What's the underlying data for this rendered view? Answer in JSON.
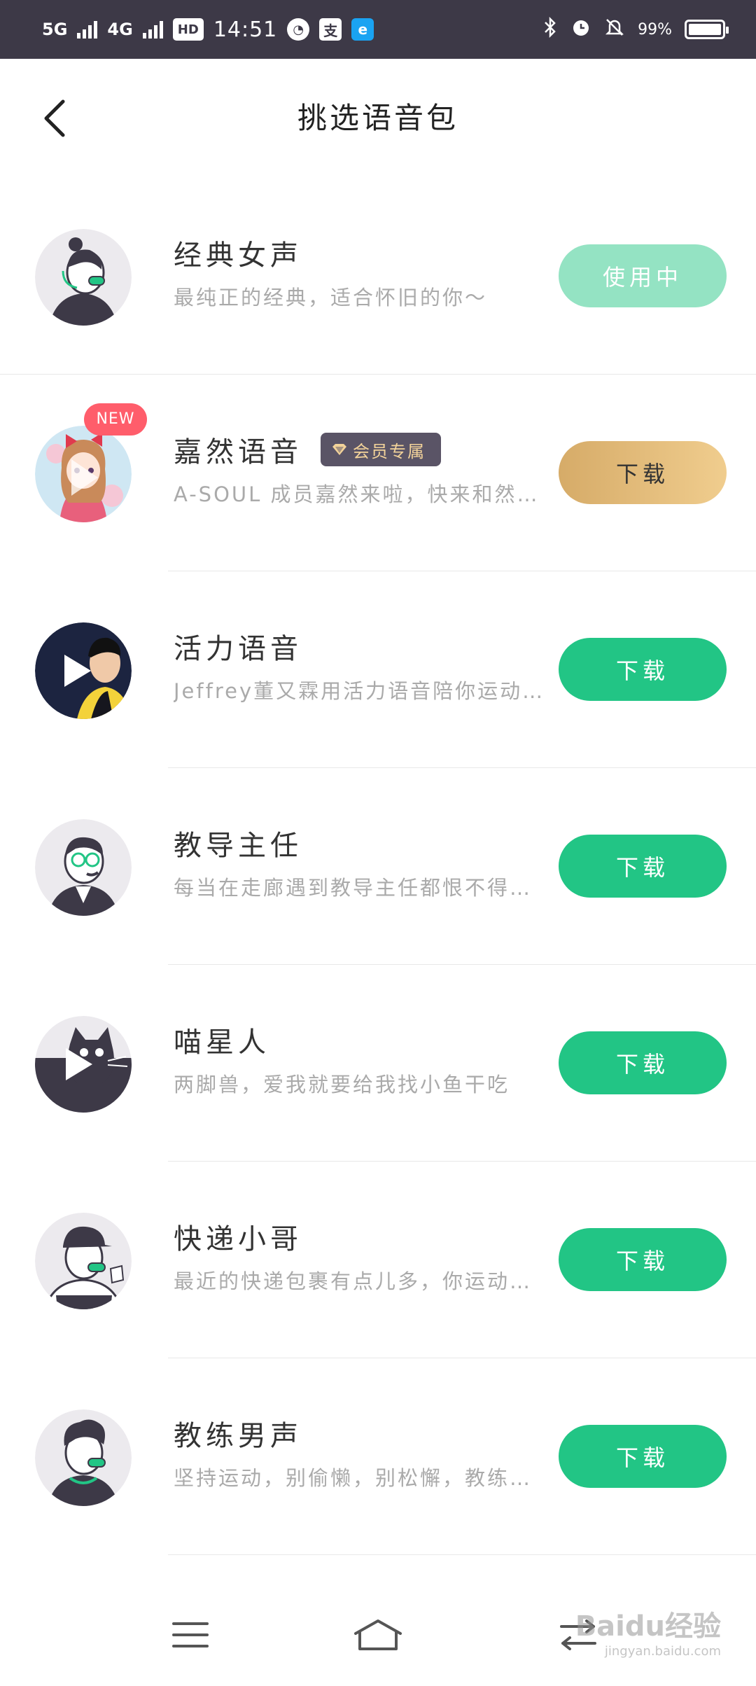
{
  "status_bar": {
    "network1": "5G",
    "network2": "4G",
    "hd": "HD",
    "time": "14:51",
    "app_badge": "支",
    "app2_badge": "e",
    "battery": "99%"
  },
  "header": {
    "title": "挑选语音包",
    "back_icon": "chevron-left-icon"
  },
  "voice_packs": [
    {
      "name": "经典女声",
      "desc": "最纯正的经典，适合怀旧的你～",
      "action": "使用中",
      "state": "in-use",
      "new": "",
      "vip": ""
    },
    {
      "name": "嘉然语音",
      "desc": "A-SOUL 成员嘉然来啦，快来和然然一起出发吧",
      "action": "下载",
      "state": "gold",
      "new": "NEW",
      "vip": "会员专属"
    },
    {
      "name": "活力语音",
      "desc": "Jeffrey董又霖用活力语音陪你运动出行",
      "action": "下载",
      "state": "green",
      "new": "",
      "vip": ""
    },
    {
      "name": "教导主任",
      "desc": "每当在走廊遇到教导主任都恨不得绕道走",
      "action": "下载",
      "state": "green",
      "new": "",
      "vip": ""
    },
    {
      "name": "喵星人",
      "desc": "两脚兽，爱我就要给我找小鱼干吃",
      "action": "下载",
      "state": "green",
      "new": "",
      "vip": ""
    },
    {
      "name": "快递小哥",
      "desc": "最近的快递包裹有点儿多，你运动一下吧",
      "action": "下载",
      "state": "green",
      "new": "",
      "vip": ""
    },
    {
      "name": "教练男声",
      "desc": "坚持运动，别偷懒，别松懈，教练陪你跑",
      "action": "下载",
      "state": "green",
      "new": "",
      "vip": ""
    }
  ],
  "nav": {
    "menu_icon": "menu-icon",
    "home_icon": "home-icon",
    "back_icon": "back-nav-icon"
  },
  "watermark": {
    "text": "Baidu经验",
    "sub": "jingyan.baidu.com"
  },
  "colors": {
    "green": "#22c585",
    "in_use": "#94e3c3",
    "gold": "#e2bd7b",
    "status_bar": "#3d3947",
    "new_badge": "#ff5d6b"
  }
}
